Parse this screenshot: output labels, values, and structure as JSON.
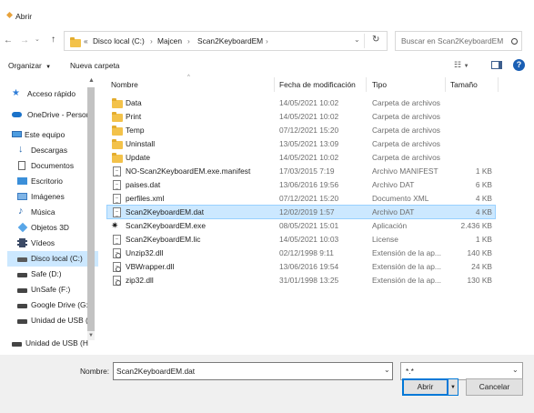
{
  "window": {
    "title": "Abrir"
  },
  "address": {
    "prefix": "«",
    "crumbs": [
      "Disco local (C:)",
      "Majcen",
      "Scan2KeyboardEM"
    ],
    "search_placeholder": "Buscar en Scan2KeyboardEM"
  },
  "toolbar": {
    "organize": "Organizar",
    "new_folder": "Nueva carpeta"
  },
  "columns": {
    "name": "Nombre",
    "date": "Fecha de modificación",
    "type": "Tipo",
    "size": "Tamaño"
  },
  "sidebar": {
    "items": [
      {
        "label": "Acceso rápido",
        "icon": "star-icon"
      },
      {
        "label": "OneDrive - Persor",
        "icon": "cloud-icon"
      },
      {
        "label": "Este equipo",
        "icon": "computer-icon"
      },
      {
        "label": "Descargas",
        "icon": "download-icon"
      },
      {
        "label": "Documentos",
        "icon": "documents-icon"
      },
      {
        "label": "Escritorio",
        "icon": "desktop-icon"
      },
      {
        "label": "Imágenes",
        "icon": "pictures-icon"
      },
      {
        "label": "Música",
        "icon": "music-icon"
      },
      {
        "label": "Objetos 3D",
        "icon": "3d-objects-icon"
      },
      {
        "label": "Vídeos",
        "icon": "videos-icon"
      },
      {
        "label": "Disco local (C:)",
        "icon": "drive-icon"
      },
      {
        "label": "Safe (D:)",
        "icon": "drive-icon"
      },
      {
        "label": "UnSafe (F:)",
        "icon": "drive-icon"
      },
      {
        "label": "Google Drive (G:",
        "icon": "drive-icon"
      },
      {
        "label": "Unidad de USB (",
        "icon": "usb-drive-icon"
      },
      {
        "label": "Unidad de USB (H",
        "icon": "usb-drive-icon"
      }
    ]
  },
  "files": [
    {
      "name": "Data",
      "date": "14/05/2021 10:02",
      "type": "Carpeta de archivos",
      "size": "",
      "icon": "folder-icon"
    },
    {
      "name": "Print",
      "date": "14/05/2021 10:02",
      "type": "Carpeta de archivos",
      "size": "",
      "icon": "folder-icon"
    },
    {
      "name": "Temp",
      "date": "07/12/2021 15:20",
      "type": "Carpeta de archivos",
      "size": "",
      "icon": "folder-icon"
    },
    {
      "name": "Uninstall",
      "date": "13/05/2021 13:09",
      "type": "Carpeta de archivos",
      "size": "",
      "icon": "folder-icon"
    },
    {
      "name": "Update",
      "date": "14/05/2021 10:02",
      "type": "Carpeta de archivos",
      "size": "",
      "icon": "folder-icon"
    },
    {
      "name": "NO-Scan2KeyboardEM.exe.manifest",
      "date": "17/03/2015 7:19",
      "type": "Archivo MANIFEST",
      "size": "1 KB",
      "icon": "file-icon"
    },
    {
      "name": "paises.dat",
      "date": "13/06/2016 19:56",
      "type": "Archivo DAT",
      "size": "6 KB",
      "icon": "file-icon"
    },
    {
      "name": "perfiles.xml",
      "date": "07/12/2021 15:20",
      "type": "Documento XML",
      "size": "4 KB",
      "icon": "xml-file-icon"
    },
    {
      "name": "Scan2KeyboardEM.dat",
      "date": "12/02/2019 1:57",
      "type": "Archivo DAT",
      "size": "4 KB",
      "icon": "file-icon",
      "selected": true
    },
    {
      "name": "Scan2KeyboardEM.exe",
      "date": "08/05/2021 15:01",
      "type": "Aplicación",
      "size": "2.436 KB",
      "icon": "app-icon"
    },
    {
      "name": "Scan2KeyboardEM.lic",
      "date": "14/05/2021 10:03",
      "type": "License",
      "size": "1 KB",
      "icon": "file-icon"
    },
    {
      "name": "Unzip32.dll",
      "date": "02/12/1998 9:11",
      "type": "Extensión de la ap...",
      "size": "140 KB",
      "icon": "dll-icon"
    },
    {
      "name": "VBWrapper.dll",
      "date": "13/06/2016 19:54",
      "type": "Extensión de la ap...",
      "size": "24 KB",
      "icon": "dll-icon"
    },
    {
      "name": "zip32.dll",
      "date": "31/01/1998 13:25",
      "type": "Extensión de la ap...",
      "size": "130 KB",
      "icon": "dll-icon"
    }
  ],
  "footer": {
    "filename_label": "Nombre:",
    "filename_value": "Scan2KeyboardEM.dat",
    "filter_value": "*.*",
    "open_label": "Abrir",
    "cancel_label": "Cancelar"
  },
  "colors": {
    "selection": "#cce8ff",
    "accent": "#0078d7",
    "folder": "#f3c24a"
  }
}
